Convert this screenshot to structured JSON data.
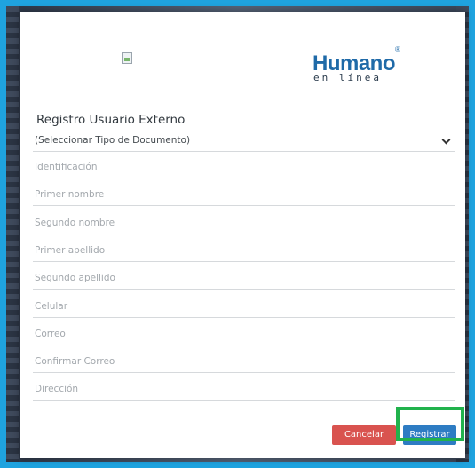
{
  "logo": {
    "main": "Humano",
    "mark": "®",
    "sub": "en línea"
  },
  "form": {
    "title": "Registro Usuario Externo",
    "document_type": "(Seleccionar Tipo de Documento)",
    "fields": [
      "Identificación",
      "Primer nombre",
      "Segundo nombre",
      "Primer apellido",
      "Segundo apellido",
      "Celular",
      "Correo",
      "Confirmar Correo",
      "Dirección"
    ]
  },
  "buttons": {
    "cancel": "Cancelar",
    "register": "Registrar"
  },
  "colors": {
    "frame": "#1fa3df",
    "logo_blue": "#1f6aa8",
    "cancel": "#d9534f",
    "register": "#2e7cc3",
    "highlight": "#21b24c"
  }
}
